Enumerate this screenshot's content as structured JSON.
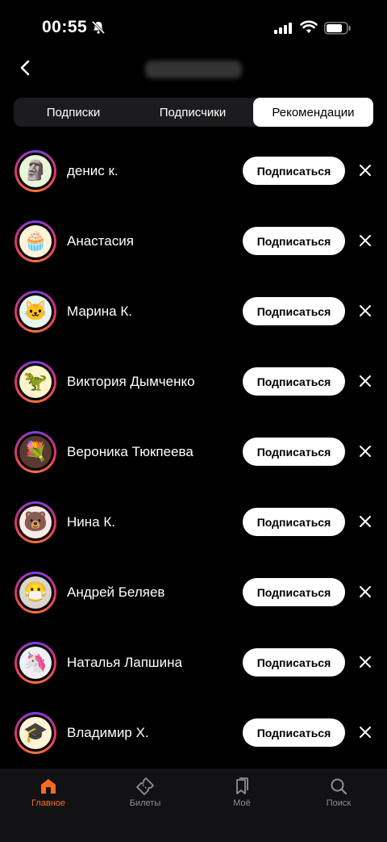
{
  "status_bar": {
    "time": "00:55"
  },
  "tabs": [
    {
      "label": "Подписки"
    },
    {
      "label": "Подписчики"
    },
    {
      "label": "Рекомендации"
    }
  ],
  "follow_button_label": "Подписаться",
  "users": [
    {
      "name": "денис к.",
      "avatar": "🗿"
    },
    {
      "name": "Анастасия",
      "avatar": "🧁"
    },
    {
      "name": "Марина К.",
      "avatar": "🐱"
    },
    {
      "name": "Виктория Дымченко",
      "avatar": "🦖"
    },
    {
      "name": "Вероника Тюкпеева",
      "avatar": "💐"
    },
    {
      "name": "Нина К.",
      "avatar": "🐻"
    },
    {
      "name": "Андрей Беляев",
      "avatar": "😷"
    },
    {
      "name": "Наталья Лапшина",
      "avatar": "🦄"
    },
    {
      "name": "Владимир Х.",
      "avatar": "🎓"
    }
  ],
  "bottom_nav": [
    {
      "label": "Главное",
      "active": true
    },
    {
      "label": "Билеты",
      "active": false
    },
    {
      "label": "Моё",
      "active": false
    },
    {
      "label": "Поиск",
      "active": false
    }
  ],
  "colors": {
    "accent": "#ff6a1f",
    "background": "#000000",
    "nav_background": "#121214"
  }
}
